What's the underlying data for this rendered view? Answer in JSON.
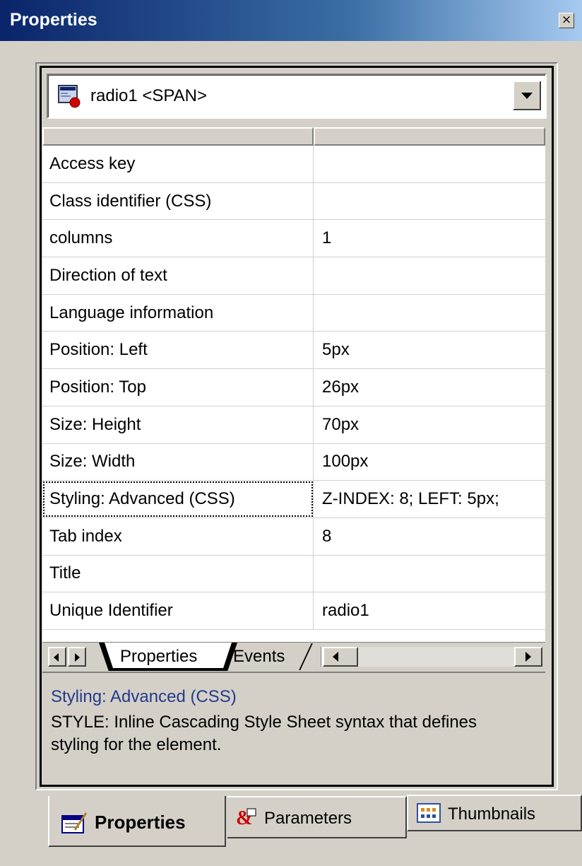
{
  "window": {
    "title": "Properties",
    "close_glyph": "×"
  },
  "object_selector": {
    "icon": "html-element-icon",
    "value": "radio1 <SPAN>"
  },
  "properties": [
    {
      "name": "Access key",
      "value": ""
    },
    {
      "name": "Class identifier (CSS)",
      "value": ""
    },
    {
      "name": "columns",
      "value": "1"
    },
    {
      "name": "Direction of text",
      "value": ""
    },
    {
      "name": "Language information",
      "value": ""
    },
    {
      "name": "Position: Left",
      "value": "5px"
    },
    {
      "name": "Position: Top",
      "value": "26px"
    },
    {
      "name": "Size: Height",
      "value": "70px"
    },
    {
      "name": "Size: Width",
      "value": "100px"
    },
    {
      "name": "Styling: Advanced (CSS)",
      "value": "Z-INDEX: 8; LEFT: 5px;"
    },
    {
      "name": "Tab index",
      "value": "8"
    },
    {
      "name": "Title",
      "value": ""
    },
    {
      "name": "Unique Identifier",
      "value": "radio1"
    }
  ],
  "selected_property_index": 9,
  "grid_tabs": {
    "properties": "Properties",
    "events": "Events",
    "active": "properties"
  },
  "description": {
    "title": "Styling: Advanced (CSS)",
    "text": "STYLE: Inline Cascading Style Sheet syntax that defines styling for the element."
  },
  "bottom_tabs": [
    {
      "label": "Properties",
      "icon": "properties-icon",
      "active": true
    },
    {
      "label": "Parameters",
      "icon": "parameters-icon",
      "active": false
    },
    {
      "label": "Thumbnails",
      "icon": "thumbnails-icon",
      "active": false
    }
  ],
  "colors": {
    "titlebar_start": "#0a246a",
    "titlebar_end": "#a6caf0",
    "description_title": "#233a8a",
    "window_bg": "#d4d0c8"
  }
}
